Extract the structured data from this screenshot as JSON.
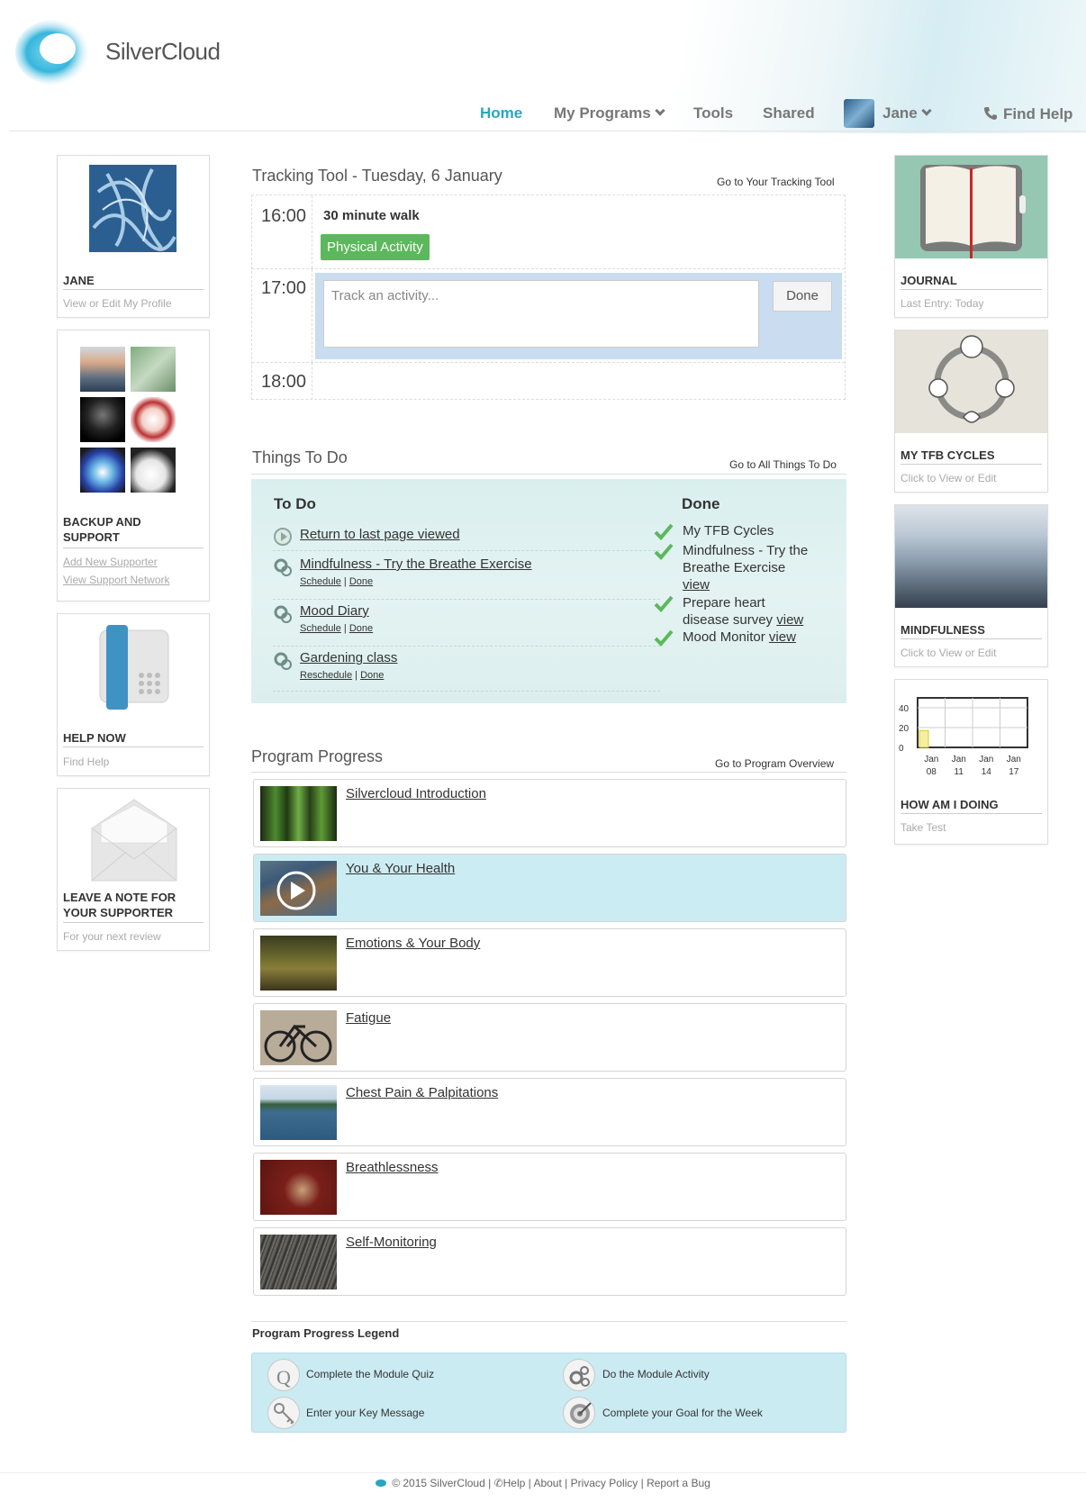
{
  "brand": {
    "name": "SilverCloud"
  },
  "nav": {
    "home": "Home",
    "programs": "My Programs",
    "tools": "Tools",
    "shared": "Shared",
    "user": "Jane",
    "help": "Find Help"
  },
  "left": {
    "profile": {
      "title": "JANE",
      "link": "View or Edit My Profile"
    },
    "backup": {
      "title": "BACKUP AND SUPPORT",
      "link1": "Add New Supporter",
      "link2": "View Support Network"
    },
    "help": {
      "title": "HELP NOW",
      "link": "Find Help"
    },
    "note": {
      "title": "LEAVE A NOTE FOR YOUR SUPPORTER",
      "link": "For your next review"
    }
  },
  "tracking": {
    "title": "Tracking Tool - Tuesday, 6 January",
    "link": "Go to Your Tracking Tool",
    "rows": [
      {
        "time": "16:00",
        "activity": "30 minute walk",
        "tag": "Physical Activity"
      },
      {
        "time": "17:00",
        "placeholder": "Track an activity...",
        "button": "Done"
      },
      {
        "time": "18:00"
      }
    ]
  },
  "todo": {
    "title": "Things To Do",
    "link": "Go to All Things To Do",
    "todo_header": "To Do",
    "done_header": "Done",
    "items": [
      {
        "label": "Return to last page viewed"
      },
      {
        "label": "Mindfulness - Try the Breathe Exercise",
        "action1": "Schedule",
        "action2": "Done"
      },
      {
        "label": "Mood Diary",
        "action1": "Schedule",
        "action2": "Done"
      },
      {
        "label": "Gardening class",
        "action1": "Reschedule",
        "action2": "Done"
      }
    ],
    "done": [
      {
        "text": "My TFB Cycles"
      },
      {
        "text": "Mindfulness - Try the Breathe Exercise",
        "view": "view"
      },
      {
        "text": "Prepare heart disease survey",
        "view": "view"
      },
      {
        "text": "Mood Monitor",
        "view": "view"
      }
    ]
  },
  "progress": {
    "title": "Program Progress",
    "link": "Go to Program Overview",
    "modules": [
      "Silvercloud Introduction",
      "You & Your Health",
      "Emotions & Your Body",
      "Fatigue",
      "Chest Pain & Palpitations",
      "Breathlessness",
      "Self-Monitoring"
    ],
    "legend_title": "Program Progress Legend",
    "legend": [
      "Complete the Module Quiz",
      "Do the Module Activity",
      "Enter your Key Message",
      "Complete your Goal for the Week"
    ]
  },
  "right": {
    "journal": {
      "title": "JOURNAL",
      "sub": "Last Entry: Today"
    },
    "cycles": {
      "title": "MY TFB CYCLES",
      "sub": "Click to View or Edit"
    },
    "mindfulness": {
      "title": "MINDFULNESS",
      "sub": "Click to View or Edit"
    },
    "doing": {
      "title": "HOW AM I DOING",
      "sub": "Take Test"
    }
  },
  "chart_data": {
    "type": "bar",
    "categories": [
      "Jan 08",
      "Jan 11",
      "Jan 14",
      "Jan 17"
    ],
    "values": [
      17,
      null,
      null,
      null
    ],
    "yticks": [
      "40",
      "20",
      "0"
    ],
    "ylim": [
      0,
      50
    ],
    "bar_color": "#f4f0a0"
  },
  "footer": {
    "copyright": "© 2015 SilverCloud",
    "help": "Help",
    "about": "About",
    "privacy": "Privacy Policy",
    "bug": "Report a Bug"
  },
  "colors": {
    "accent": "#2aa5c0",
    "green": "#5cb85c",
    "panel": "#dcefee",
    "highlight": "#ccecf3"
  }
}
